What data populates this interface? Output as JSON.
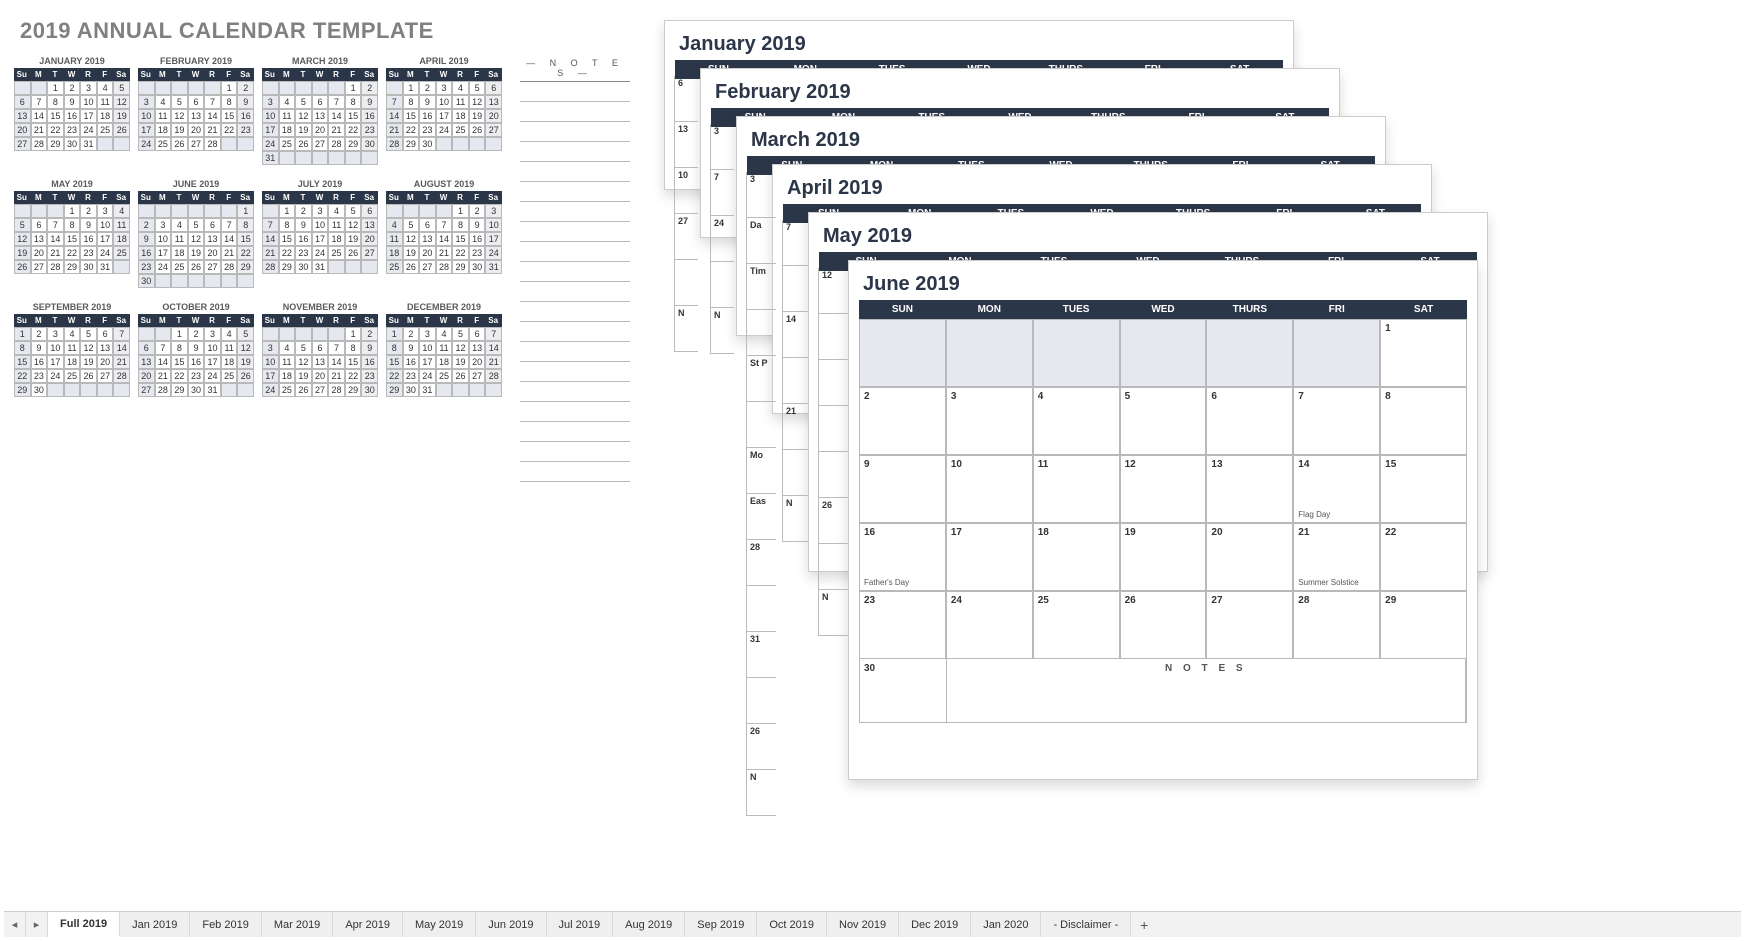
{
  "title": "2019 ANNUAL CALENDAR TEMPLATE",
  "day_headers_mini": [
    "Su",
    "M",
    "T",
    "W",
    "R",
    "F",
    "Sa"
  ],
  "day_headers_full": [
    "SUN",
    "MON",
    "TUES",
    "WED",
    "THURS",
    "FRI",
    "SAT"
  ],
  "notes_header": "— N O T E S —",
  "notes_label": "N O T E S",
  "months": [
    {
      "name": "JANUARY 2019",
      "start": 2,
      "days": 31
    },
    {
      "name": "FEBRUARY 2019",
      "start": 5,
      "days": 28
    },
    {
      "name": "MARCH 2019",
      "start": 5,
      "days": 31
    },
    {
      "name": "APRIL 2019",
      "start": 1,
      "days": 30
    },
    {
      "name": "MAY 2019",
      "start": 3,
      "days": 31
    },
    {
      "name": "JUNE 2019",
      "start": 6,
      "days": 30
    },
    {
      "name": "JULY 2019",
      "start": 1,
      "days": 31
    },
    {
      "name": "AUGUST 2019",
      "start": 4,
      "days": 31
    },
    {
      "name": "SEPTEMBER 2019",
      "start": 0,
      "days": 30
    },
    {
      "name": "OCTOBER 2019",
      "start": 2,
      "days": 31
    },
    {
      "name": "NOVEMBER 2019",
      "start": 5,
      "days": 30
    },
    {
      "name": "DECEMBER 2019",
      "start": 0,
      "days": 31
    }
  ],
  "stack_pages": [
    {
      "title": "January 2019"
    },
    {
      "title": "February 2019"
    },
    {
      "title": "March 2019"
    },
    {
      "title": "April 2019"
    },
    {
      "title": "May 2019"
    }
  ],
  "visible_left_strip": {
    "jan": [
      "6",
      "13",
      "10",
      "27",
      "",
      "N"
    ],
    "feb": [
      "3",
      "7",
      "24",
      "",
      "N"
    ],
    "mar": [
      "3",
      "Da",
      "Tim",
      "",
      "St P",
      "",
      "Mo",
      "Eas",
      "28",
      "",
      "31",
      "",
      "26",
      "N"
    ],
    "apr": [
      "7",
      "",
      "14",
      "",
      "21",
      "",
      "N"
    ],
    "may": [
      "12",
      "",
      "",
      "",
      "",
      "26",
      "",
      "N"
    ]
  },
  "june": {
    "title": "June 2019",
    "start": 6,
    "days": 30,
    "events": {
      "14": "Flag Day",
      "16": "Father's Day",
      "21": "Summer Solstice"
    }
  },
  "tabs": [
    "Full 2019",
    "Jan 2019",
    "Feb 2019",
    "Mar 2019",
    "Apr 2019",
    "May 2019",
    "Jun 2019",
    "Jul 2019",
    "Aug 2019",
    "Sep 2019",
    "Oct 2019",
    "Nov 2019",
    "Dec 2019",
    "Jan 2020",
    "- Disclaimer -"
  ],
  "active_tab": 0,
  "nav": {
    "left": "◂",
    "right": "▸",
    "add": "+"
  }
}
